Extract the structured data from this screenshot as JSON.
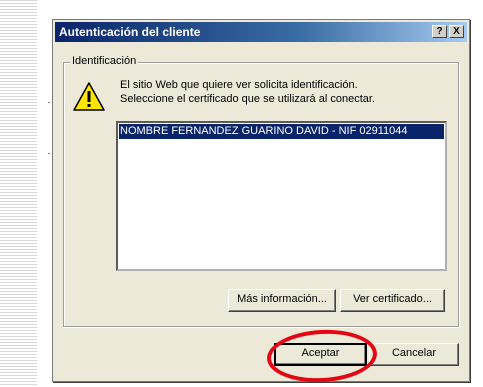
{
  "dialog": {
    "title": "Autenticación del cliente",
    "help_label": "?",
    "close_label": "X"
  },
  "group": {
    "legend": "Identificación",
    "message_line1": "El sitio Web que quiere ver solicita identificación.",
    "message_line2": "Seleccione el certificado que se utilizará al conectar."
  },
  "certificates": [
    "NOMBRE FERNANDEZ GUARINO DAVID - NIF 02911044"
  ],
  "buttons": {
    "more_info": "Más información...",
    "view_cert": "Ver certificado...",
    "accept": "Aceptar",
    "cancel": "Cancelar"
  },
  "icons": {
    "warning": "warning-icon"
  },
  "colors": {
    "titlebar": "#0a246a",
    "selection": "#0a246a",
    "annotation_circle": "#e30613"
  }
}
